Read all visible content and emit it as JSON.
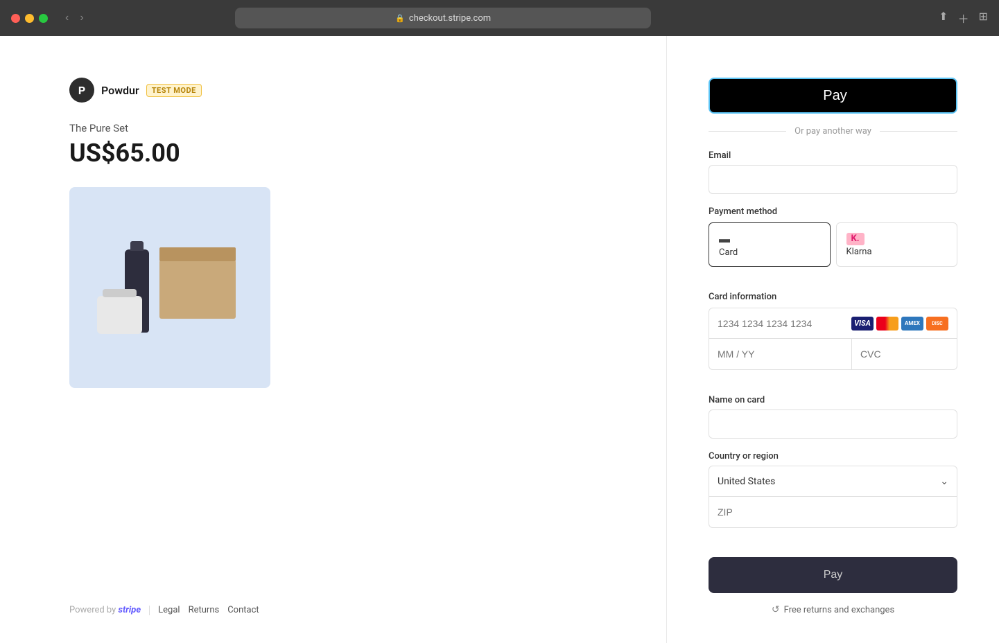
{
  "browser": {
    "url": "checkout.stripe.com",
    "url_display": "checkout.stripe.com"
  },
  "brand": {
    "initial": "P",
    "name": "Powdur",
    "badge": "TEST MODE"
  },
  "product": {
    "name": "The Pure Set",
    "price": "US$65.00"
  },
  "apple_pay": {
    "label": "Pay",
    "apple_symbol": ""
  },
  "divider": {
    "text": "Or pay another way"
  },
  "form": {
    "email_label": "Email",
    "email_placeholder": "",
    "payment_method_label": "Payment method",
    "payment_methods": [
      {
        "id": "card",
        "label": "Card",
        "selected": true
      },
      {
        "id": "klarna",
        "label": "Klarna",
        "selected": false
      }
    ],
    "card_info_label": "Card information",
    "card_number_placeholder": "1234 1234 1234 1234",
    "expiry_placeholder": "MM / YY",
    "cvc_placeholder": "CVC",
    "name_on_card_label": "Name on card",
    "name_on_card_placeholder": "",
    "country_label": "Country or region",
    "country_value": "United States",
    "zip_placeholder": "ZIP"
  },
  "card_icons": [
    {
      "name": "visa",
      "label": "VISA"
    },
    {
      "name": "mastercard",
      "label": "MC"
    },
    {
      "name": "amex",
      "label": "AMEX"
    },
    {
      "name": "discover",
      "label": "DISC"
    }
  ],
  "pay_button": {
    "label": "Pay"
  },
  "free_returns": {
    "text": "Free returns and exchanges"
  },
  "footer": {
    "powered_by": "Powered by",
    "stripe": "stripe",
    "links": [
      "Legal",
      "Returns",
      "Contact"
    ]
  }
}
